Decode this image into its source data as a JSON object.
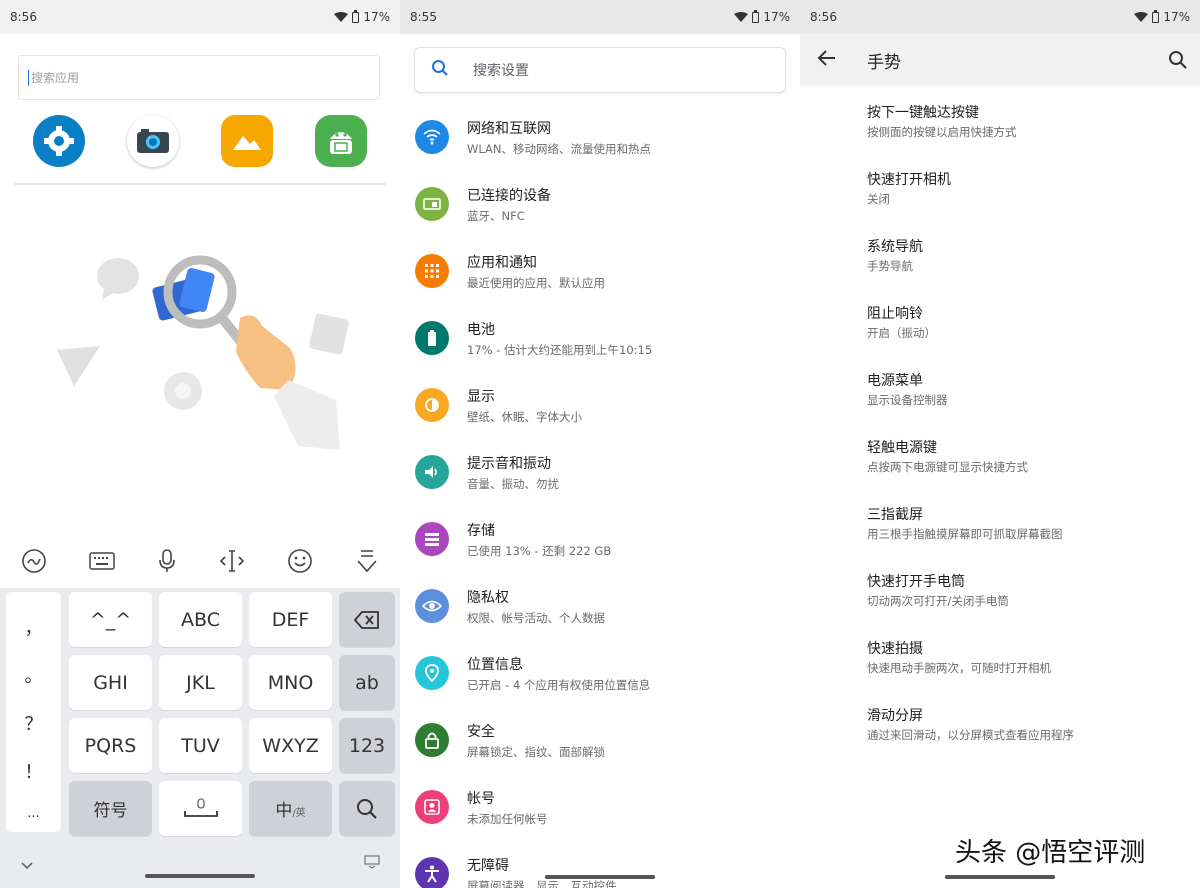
{
  "status": {
    "left_time": "8:56",
    "middle_time": "8:55",
    "right_time": "8:56",
    "battery": "17%"
  },
  "launcher": {
    "search_placeholder": "搜索应用",
    "apps": [
      {
        "name": "settings-app-icon",
        "color": "#0b7fc5"
      },
      {
        "name": "camera-app-icon",
        "color": "#ffffff"
      },
      {
        "name": "gallery-app-icon",
        "color": "#f6a800"
      },
      {
        "name": "android-app-icon",
        "color": "#4caf50"
      }
    ]
  },
  "keyboard": {
    "toolbar_icons": [
      "handwriting-icon",
      "keyboard-icon",
      "microphone-icon",
      "cursor-move-icon",
      "emoji-icon",
      "collapse-keyboard-icon"
    ],
    "punctuation": [
      "，",
      "。",
      "？",
      "！",
      "..."
    ],
    "keys": [
      {
        "label": "^_^",
        "kind": "light"
      },
      {
        "label": "ABC",
        "kind": "light"
      },
      {
        "label": "DEF",
        "kind": "light"
      },
      {
        "label": "GHI",
        "kind": "light"
      },
      {
        "label": "JKL",
        "kind": "light"
      },
      {
        "label": "MNO",
        "kind": "light"
      },
      {
        "label": "PQRS",
        "kind": "light"
      },
      {
        "label": "TUV",
        "kind": "light"
      },
      {
        "label": "WXYZ",
        "kind": "light"
      }
    ],
    "side_keys": {
      "delete": "delete-icon",
      "ab": "ab",
      "num": "123",
      "search": "search-icon"
    },
    "bottom_keys": {
      "symbols": "符号",
      "lang_main": "中",
      "lang_sub": "/英"
    }
  },
  "settings": {
    "search_placeholder": "搜索设置",
    "items": [
      {
        "title": "网络和互联网",
        "subtitle": "WLAN、移动网络、流量使用和热点",
        "color": "#1e88e5",
        "icon": "wifi-icon"
      },
      {
        "title": "已连接的设备",
        "subtitle": "蓝牙、NFC",
        "color": "#7cb342",
        "icon": "devices-icon"
      },
      {
        "title": "应用和通知",
        "subtitle": "最近使用的应用、默认应用",
        "color": "#f57c00",
        "icon": "apps-icon"
      },
      {
        "title": "电池",
        "subtitle": "17% - 估计大约还能用到上午10:15",
        "color": "#00796b",
        "icon": "battery-icon"
      },
      {
        "title": "显示",
        "subtitle": "壁纸、休眠、字体大小",
        "color": "#f9a825",
        "icon": "brightness-icon"
      },
      {
        "title": "提示音和振动",
        "subtitle": "音量、振动、勿扰",
        "color": "#26a69a",
        "icon": "volume-icon"
      },
      {
        "title": "存储",
        "subtitle": "已使用 13% - 还剩 222 GB",
        "color": "#ab47bc",
        "icon": "storage-icon"
      },
      {
        "title": "隐私权",
        "subtitle": "权限、帐号活动、个人数据",
        "color": "#5c8fdc",
        "icon": "privacy-icon"
      },
      {
        "title": "位置信息",
        "subtitle": "已开启 - 4 个应用有权使用位置信息",
        "color": "#26c6da",
        "icon": "location-icon"
      },
      {
        "title": "安全",
        "subtitle": "屏幕锁定、指纹、面部解锁",
        "color": "#2e7d32",
        "icon": "lock-icon"
      },
      {
        "title": "帐号",
        "subtitle": "未添加任何帐号",
        "color": "#ec407a",
        "icon": "account-icon"
      },
      {
        "title": "无障碍",
        "subtitle": "屏幕阅读器、显示、互动控件",
        "color": "#5e35b1",
        "icon": "accessibility-icon"
      }
    ]
  },
  "gestures": {
    "title": "手势",
    "items": [
      {
        "title": "按下一键触达按键",
        "subtitle": "按侧面的按键以启用快捷方式"
      },
      {
        "title": "快速打开相机",
        "subtitle": "关闭"
      },
      {
        "title": "系统导航",
        "subtitle": "手势导航"
      },
      {
        "title": "阻止响铃",
        "subtitle": "开启（振动）"
      },
      {
        "title": "电源菜单",
        "subtitle": "显示设备控制器"
      },
      {
        "title": "轻触电源键",
        "subtitle": "点按两下电源键可显示快捷方式"
      },
      {
        "title": "三指截屏",
        "subtitle": "用三根手指触摸屏幕即可抓取屏幕截图"
      },
      {
        "title": "快速打开手电筒",
        "subtitle": "切动两次可打开/关闭手电筒"
      },
      {
        "title": "快速拍摄",
        "subtitle": "快速甩动手腕两次，可随时打开相机"
      },
      {
        "title": "滑动分屏",
        "subtitle": "通过来回滑动，以分屏模式查看应用程序"
      }
    ]
  },
  "watermark": "头条 @悟空评测"
}
